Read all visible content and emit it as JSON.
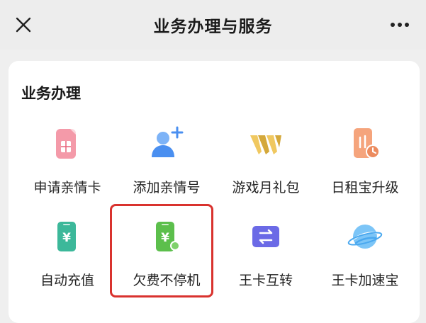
{
  "header": {
    "title": "业务办理与服务",
    "close_icon": "close-icon",
    "more_icon": "more-icon"
  },
  "section": {
    "title": "业务办理"
  },
  "items": [
    {
      "label": "申请亲情卡",
      "icon": "sim-card-icon",
      "color": "#e8637a"
    },
    {
      "label": "添加亲情号",
      "icon": "add-user-icon",
      "color": "#4a8ff0"
    },
    {
      "label": "游戏月礼包",
      "icon": "game-w-icon",
      "color": "#d4a83a"
    },
    {
      "label": "日租宝升级",
      "icon": "phone-clock-icon",
      "color": "#ec8b5e"
    },
    {
      "label": "自动充值",
      "icon": "yuan-phone-icon",
      "color": "#3cb89a"
    },
    {
      "label": "欠费不停机",
      "icon": "yuan-phone-green-icon",
      "color": "#5cbf4c"
    },
    {
      "label": "王卡互转",
      "icon": "swap-card-icon",
      "color": "#6b6ae6"
    },
    {
      "label": "王卡加速宝",
      "icon": "planet-icon",
      "color": "#49a8ef"
    }
  ],
  "highlight_color": "#d9322e"
}
